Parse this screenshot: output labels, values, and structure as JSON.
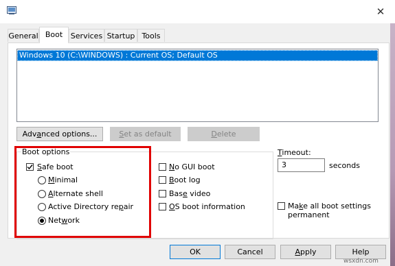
{
  "window": {
    "close_glyph": "✕"
  },
  "tabs": [
    {
      "label": "General",
      "active": false
    },
    {
      "label": "Boot",
      "active": true
    },
    {
      "label": "Services",
      "active": false
    },
    {
      "label": "Startup",
      "active": false
    },
    {
      "label": "Tools",
      "active": false
    }
  ],
  "os_list": {
    "items": [
      "Windows 10 (C:\\WINDOWS) : Current OS; Default OS"
    ],
    "selected_index": 0
  },
  "list_buttons": {
    "advanced": {
      "prefix": "Adv",
      "mnemonic": "a",
      "suffix": "nced options...",
      "enabled": true
    },
    "set_default": {
      "prefix": "",
      "mnemonic": "S",
      "suffix": "et as default",
      "enabled": false
    },
    "delete": {
      "prefix": "",
      "mnemonic": "D",
      "suffix": "elete",
      "enabled": false
    }
  },
  "boot_options": {
    "group_label": "Boot options",
    "safe_boot": {
      "prefix": "",
      "mnemonic": "S",
      "suffix": "afe boot",
      "checked": true
    },
    "radios": [
      {
        "prefix": "",
        "mnemonic": "M",
        "suffix": "inimal",
        "selected": false
      },
      {
        "prefix": "",
        "mnemonic": "A",
        "suffix": "lternate shell",
        "selected": false
      },
      {
        "prefix": "Active Directory re",
        "mnemonic": "p",
        "suffix": "air",
        "selected": false
      },
      {
        "prefix": "Net",
        "mnemonic": "w",
        "suffix": "ork",
        "selected": true
      }
    ],
    "checks": [
      {
        "prefix": "",
        "mnemonic": "N",
        "suffix": "o GUI boot",
        "checked": false
      },
      {
        "prefix": "",
        "mnemonic": "B",
        "suffix": "oot log",
        "checked": false
      },
      {
        "prefix": "Bas",
        "mnemonic": "e",
        "suffix": " video",
        "checked": false
      },
      {
        "prefix": "",
        "mnemonic": "O",
        "suffix": "S boot information",
        "checked": false
      }
    ]
  },
  "timeout": {
    "label_prefix": "",
    "label_mnemonic": "T",
    "label_suffix": "imeout:",
    "value": "3",
    "unit": "seconds"
  },
  "make_permanent": {
    "line1_prefix": "Ma",
    "line1_mnemonic": "k",
    "line1_suffix": "e all boot settings",
    "line2": "permanent",
    "checked": false
  },
  "dialog_buttons": {
    "ok": "OK",
    "cancel": "Cancel",
    "apply_prefix": "",
    "apply_mnemonic": "A",
    "apply_suffix": "pply",
    "help": "Help"
  },
  "watermark": "wsxdn.com",
  "colors": {
    "selection": "#0078d7",
    "highlight_box": "#e00000"
  }
}
